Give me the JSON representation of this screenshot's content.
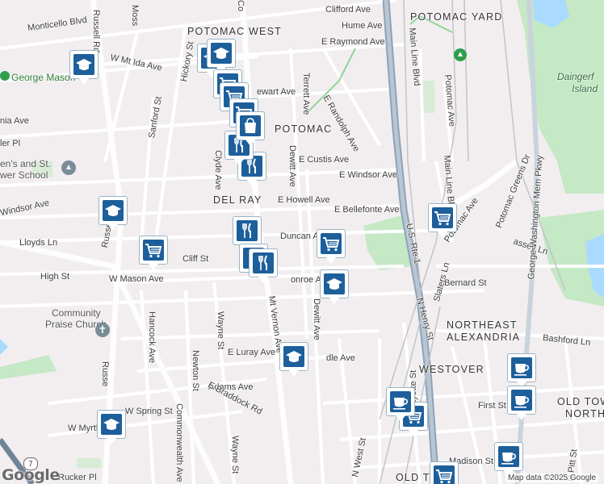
{
  "map": {
    "area_labels": [
      {
        "id": "potomac-west",
        "text": "POTOMAC WEST"
      },
      {
        "id": "potomac-yard",
        "text": "POTOMAC YARD"
      },
      {
        "id": "potomac",
        "text": "POTOMAC"
      },
      {
        "id": "del-ray",
        "text": "DEL RAY"
      },
      {
        "id": "northeast",
        "text": "NORTHEAST"
      },
      {
        "id": "alexandria",
        "text": "ALEXANDRIA"
      },
      {
        "id": "westover",
        "text": "WESTOVER"
      },
      {
        "id": "old-town-1",
        "text": "OLD TOWN"
      },
      {
        "id": "north",
        "text": "NORTH"
      },
      {
        "id": "old-town-2",
        "text": "OLD TOWN"
      }
    ],
    "park_labels": [
      {
        "id": "daingerfield",
        "line1": "Daingerf",
        "line2": "Island"
      }
    ],
    "poi_labels": [
      {
        "id": "george-mason",
        "text": "George Mason"
      },
      {
        "id": "community-praise",
        "line1": "Community",
        "line2": "Praise Church"
      },
      {
        "id": "school",
        "line1": "en's and St.",
        "line2": "wer School"
      }
    ],
    "streets": {
      "clifford": "Clifford Ave",
      "hume": "Hume Ave",
      "raymond": "E Raymond Ave",
      "monticello": "Monticello Blvd",
      "ida": "W Mt Ida Ave",
      "stewart": "ewart Ave",
      "custis": "E Custis Ave",
      "windsor_e": "E Windsor Ave",
      "windsor_w": "Windsor Ave",
      "howell": "E Howell Ave",
      "bellefonte": "E Bellefonte Ave",
      "lloyds": "Lloyds Ln",
      "duncan": "Duncan Ave",
      "cliff": "Cliff St",
      "high": "High St",
      "mason": "W Mason Ave",
      "monroe": "onroe Ave",
      "bernard": "Bernard St",
      "luray": "E Luray Ave",
      "bashford": "Bashford Ln",
      "adams": "Adams Ave",
      "spring": "W Spring St",
      "myrtle": "W Myrtle St",
      "braddock": "E Braddock Rd",
      "first": "First St",
      "madison": "Madison St",
      "rucker": "Rucker Pl",
      "dle": "dle Ave",
      "nia": "nia Ave",
      "ler": "ler Pl",
      "russell_top": "Russell Rd",
      "russell_mid": "Russell Rd",
      "russell_bot": "Russe",
      "moss": "Moss",
      "hickory": "Hickory St",
      "sanford": "Sanford St",
      "hancock": "Hancock Ave",
      "newton": "Newton St",
      "commonwealth": "Commonwealth Ave",
      "wayne1": "Wayne St",
      "wayne2": "Wayne St",
      "clyde": "Clyde Ave",
      "terrett": "Terrett Ave",
      "dewitt1": "Dewitt Ave",
      "dewitt2": "Dewitt Ave",
      "randolph": "E Randolph Ave",
      "mtvernon": "Mt Vernon Ave",
      "mainline1": "Main Line Blvd",
      "mainline2": "Main Line Blvd",
      "potomac_ave": "Potomac Ave",
      "potomac_ave2": "Potomac Ave",
      "greens": "Potomac Greens Dr",
      "gwmp": "George Washington Mem Pkwy",
      "us1": "U.S. Rte 1",
      "henry": "N Henry St",
      "fayette": "N Fayette St",
      "slaters": "Slaters Ln",
      "pitt": "N Pitt St",
      "west": "N West St",
      "assey": "assey Ln",
      "co": "Co",
      "potomac_e": "Potomac",
      "ln": "Ln"
    },
    "route_shield": "7",
    "attribution": "Map data ©2025 Google",
    "logo": "Google",
    "colors": {
      "water": "#aadaff",
      "park": "#c5e8c5",
      "highway": "#8fa3b8",
      "marker": "#1d5f9b",
      "background": "#f2eef0"
    }
  },
  "markers": [
    {
      "icon": "school-icon"
    },
    {
      "icon": "school-icon"
    },
    {
      "icon": "school-icon"
    },
    {
      "icon": "school-icon"
    },
    {
      "icon": "school-icon"
    },
    {
      "icon": "school-icon"
    },
    {
      "icon": "school-icon"
    },
    {
      "icon": "grocery-cart-icon"
    },
    {
      "icon": "grocery-cart-icon"
    },
    {
      "icon": "grocery-cart-icon"
    },
    {
      "icon": "grocery-cart-icon"
    },
    {
      "icon": "grocery-cart-icon"
    },
    {
      "icon": "grocery-cart-icon"
    },
    {
      "icon": "grocery-cart-icon"
    },
    {
      "icon": "grocery-cart-icon"
    },
    {
      "icon": "restaurant-icon"
    },
    {
      "icon": "restaurant-icon"
    },
    {
      "icon": "restaurant-icon"
    },
    {
      "icon": "restaurant-icon"
    },
    {
      "icon": "restaurant-icon"
    },
    {
      "icon": "cafe-icon"
    },
    {
      "icon": "cafe-icon"
    },
    {
      "icon": "cafe-icon"
    },
    {
      "icon": "cafe-icon"
    },
    {
      "icon": "shopping-bag-icon"
    }
  ]
}
